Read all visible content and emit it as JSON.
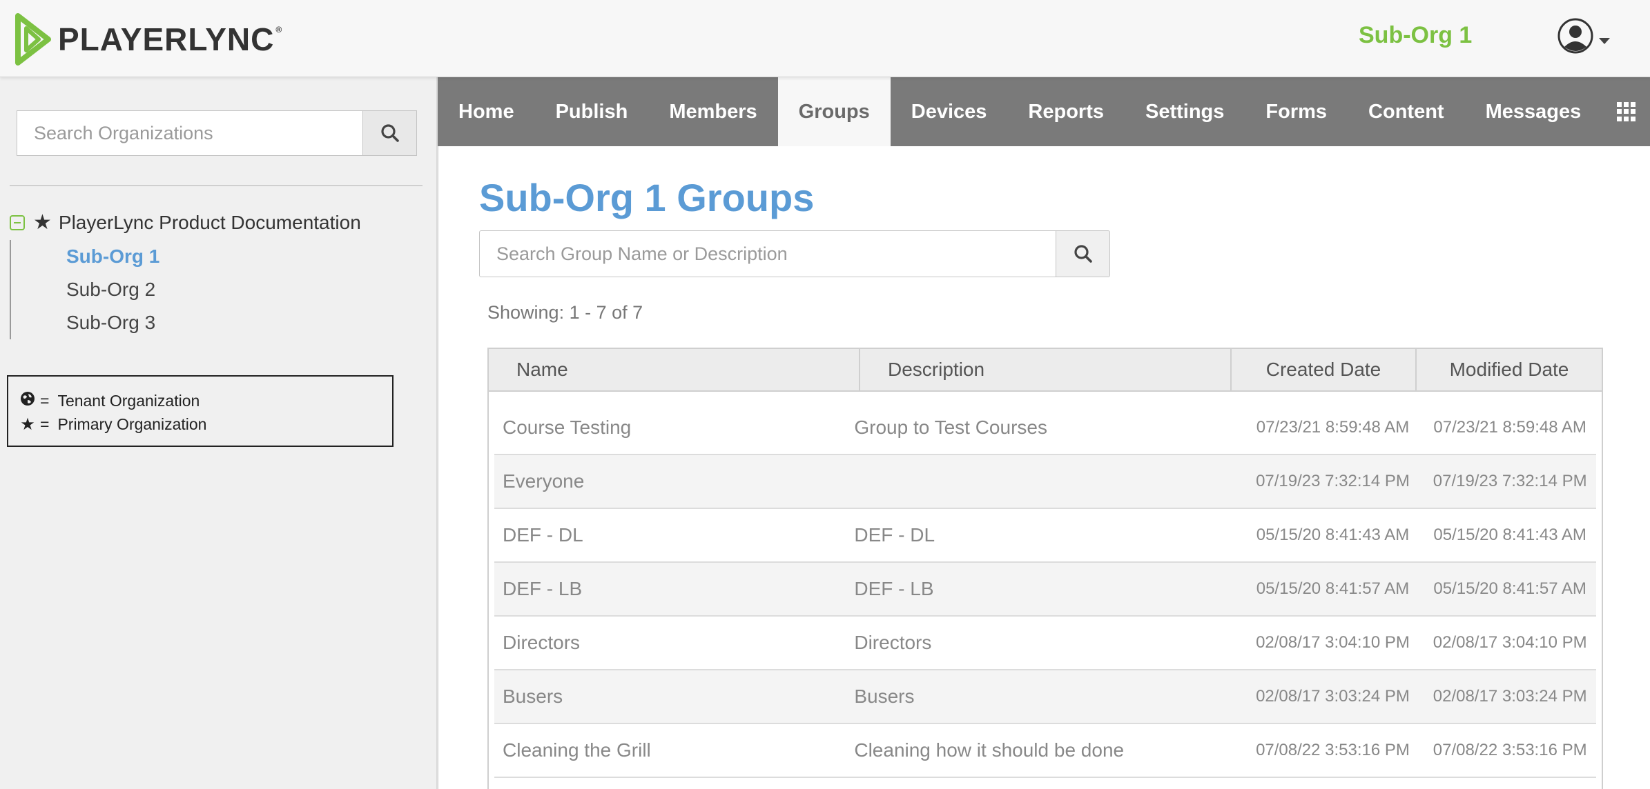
{
  "header": {
    "logo_text": "PLAYERLYNC",
    "logo_mark": "®",
    "org_name": "Sub-Org 1",
    "user_icon": "user-avatar-icon"
  },
  "sidebar": {
    "search_placeholder": "Search Organizations",
    "tree": {
      "root_label": "PlayerLync Product Documentation",
      "children": [
        {
          "label": "Sub-Org 1",
          "active": true
        },
        {
          "label": "Sub-Org 2",
          "active": false
        },
        {
          "label": "Sub-Org 3",
          "active": false
        }
      ]
    },
    "legend": {
      "rows": [
        {
          "symbol": "globe-icon",
          "eq": "=",
          "label": "Tenant Organization"
        },
        {
          "symbol": "star-icon",
          "eq": "=",
          "label": "Primary Organization"
        }
      ]
    }
  },
  "nav": {
    "items": [
      "Home",
      "Publish",
      "Members",
      "Groups",
      "Devices",
      "Reports",
      "Settings",
      "Forms",
      "Content",
      "Messages"
    ],
    "active": "Groups"
  },
  "main": {
    "title": "Sub-Org 1 Groups",
    "search_placeholder": "Search Group Name or Description",
    "showing": "Showing: 1 - 7 of 7",
    "table": {
      "columns": [
        "Name",
        "Description",
        "Created Date",
        "Modified Date"
      ],
      "rows": [
        [
          "Course Testing",
          "Group to Test Courses",
          "07/23/21 8:59:48 AM",
          "07/23/21 8:59:48 AM"
        ],
        [
          "Everyone",
          "",
          "07/19/23 7:32:14 PM",
          "07/19/23 7:32:14 PM"
        ],
        [
          "DEF - DL",
          "DEF - DL",
          "05/15/20 8:41:43 AM",
          "05/15/20 8:41:43 AM"
        ],
        [
          "DEF - LB",
          "DEF - LB",
          "05/15/20 8:41:57 AM",
          "05/15/20 8:41:57 AM"
        ],
        [
          "Directors",
          "Directors",
          "02/08/17 3:04:10 PM",
          "02/08/17 3:04:10 PM"
        ],
        [
          "Busers",
          "Busers",
          "02/08/17 3:03:24 PM",
          "02/08/17 3:03:24 PM"
        ],
        [
          "Cleaning the Grill",
          "Cleaning how it should be done",
          "07/08/22 3:53:16 PM",
          "07/08/22 3:53:16 PM"
        ]
      ]
    }
  },
  "colors": {
    "brand_green": "#7cc142",
    "title_blue": "#5b9bd5",
    "nav_gray": "#7a7a7a"
  }
}
